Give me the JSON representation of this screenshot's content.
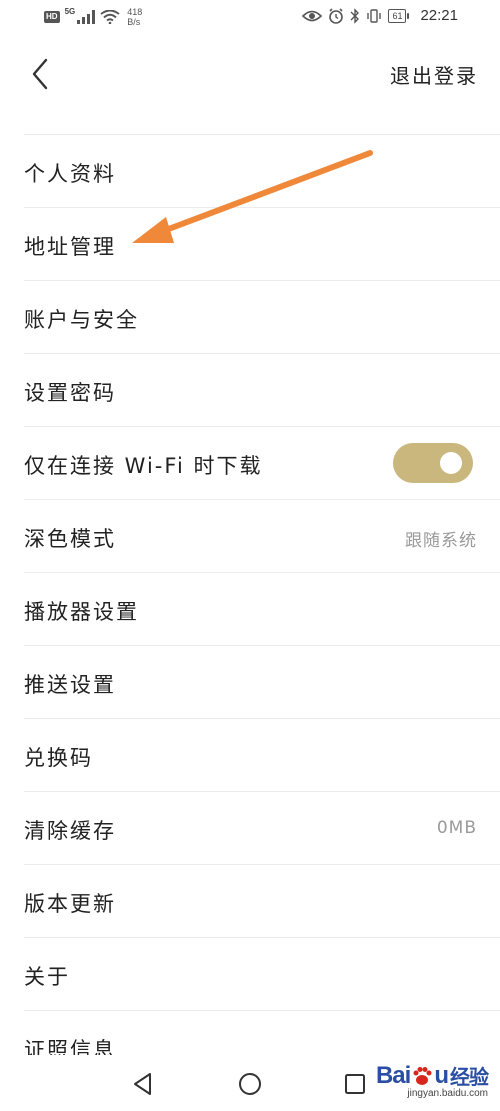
{
  "status_bar": {
    "hd": "HD",
    "signal_label": "5G",
    "net_speed_value": "418",
    "net_speed_unit": "B/s",
    "battery": "61",
    "time": "22:21"
  },
  "header": {
    "logout_label": "退出登录"
  },
  "menu": {
    "items": [
      {
        "label": "个人资料"
      },
      {
        "label": "地址管理"
      },
      {
        "label": "账户与安全"
      },
      {
        "label": "设置密码"
      },
      {
        "label": "仅在连接 Wi-Fi 时下载",
        "toggle_on": true
      },
      {
        "label": "深色模式",
        "value": "跟随系统"
      },
      {
        "label": "播放器设置"
      },
      {
        "label": "推送设置"
      },
      {
        "label": "兑换码"
      },
      {
        "label": "清除缓存",
        "value": "0MB"
      },
      {
        "label": "版本更新"
      },
      {
        "label": "关于"
      },
      {
        "label": "证照信息"
      }
    ]
  },
  "annotation": {
    "arrow_color": "#f0883a",
    "points_to": "地址管理"
  },
  "colors": {
    "toggle_on": "#c9b77e",
    "divider": "#ececec",
    "secondary_text": "#9a9a9a"
  },
  "watermark": {
    "logo_left": "Bai",
    "logo_right": "u",
    "logo_cn": "经验",
    "url": "jingyan.baidu.com"
  }
}
